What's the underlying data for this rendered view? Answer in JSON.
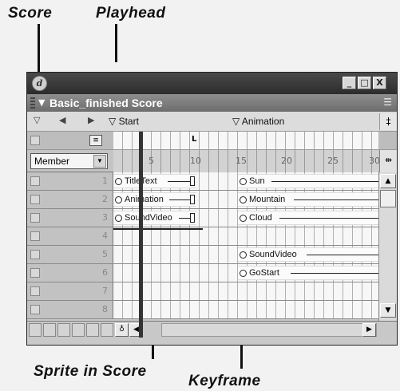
{
  "callouts": {
    "score": "Score",
    "playhead": "Playhead",
    "sprite_in_score": "Sprite in Score",
    "keyframe": "Keyframe"
  },
  "window": {
    "title_buttons": [
      "_",
      "□",
      "X"
    ],
    "panel_title": "Basic_finished Score",
    "icons": {
      "app": "director-logo-icon",
      "panel_menu": "panel-options-icon",
      "collapse": "triangle-down-icon"
    }
  },
  "markers": {
    "start": "Start",
    "animation": "Animation",
    "end_symbol": "‡"
  },
  "label_channel": {
    "playhead_label": "L"
  },
  "member_select": {
    "value": "Member",
    "arrow": "▼"
  },
  "frame_numbers": [
    "5",
    "10",
    "15",
    "20",
    "25",
    "30"
  ],
  "channels": [
    {
      "num": "1"
    },
    {
      "num": "2"
    },
    {
      "num": "3"
    },
    {
      "num": "4"
    },
    {
      "num": "5"
    },
    {
      "num": "6"
    },
    {
      "num": "7"
    },
    {
      "num": "8"
    }
  ],
  "sprites": [
    {
      "label": "TitleText"
    },
    {
      "label": "Animation"
    },
    {
      "label": "SoundVideo"
    },
    {
      "label": "Sun"
    },
    {
      "label": "Mountain"
    },
    {
      "label": "Cloud"
    },
    {
      "label": "SoundVideo"
    },
    {
      "label": "GoStart"
    }
  ]
}
